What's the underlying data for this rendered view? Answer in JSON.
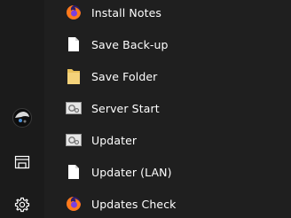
{
  "apps": [
    {
      "label": "Install Notes",
      "icon": "firefox-icon"
    },
    {
      "label": "Save Back-up",
      "icon": "document-icon"
    },
    {
      "label": "Save Folder",
      "icon": "folder-icon"
    },
    {
      "label": "Server Start",
      "icon": "settings-shortcut-icon"
    },
    {
      "label": "Updater",
      "icon": "settings-shortcut-icon"
    },
    {
      "label": "Updater (LAN)",
      "icon": "document-icon"
    },
    {
      "label": "Updates Check",
      "icon": "firefox-icon"
    }
  ],
  "rail": [
    "user-avatar-icon",
    "documents-icon",
    "settings-gear-icon"
  ],
  "colors": {
    "background": "#1f1f1f",
    "rail": "#1b1b1b",
    "text": "#ffffff",
    "folder": "#e8c15b"
  }
}
